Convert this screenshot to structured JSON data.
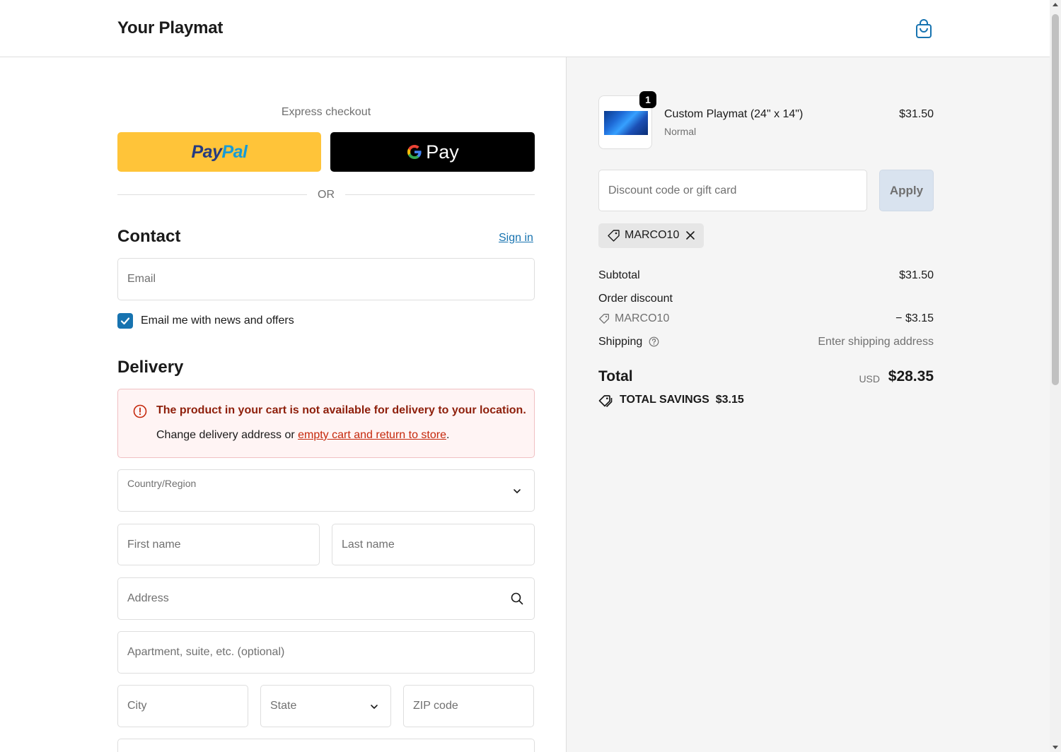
{
  "header": {
    "store_title": "Your Playmat",
    "cart_icon": "shopping-bag-icon"
  },
  "express": {
    "label": "Express checkout",
    "paypal_a": "Pay",
    "paypal_b": "Pal",
    "gpay_text": "Pay",
    "or_label": "OR"
  },
  "contact": {
    "heading": "Contact",
    "sign_in": "Sign in",
    "email_placeholder": "Email",
    "newsletter_label": "Email me with news and offers",
    "newsletter_checked": true
  },
  "delivery": {
    "heading": "Delivery",
    "alert_title": "The product in your cart is not available for delivery to your location.",
    "alert_body_prefix": "Change delivery address or ",
    "alert_link": "empty cart and return to store",
    "alert_body_suffix": ".",
    "country_label": "Country/Region",
    "country_value": "",
    "first_name_placeholder": "First name",
    "last_name_placeholder": "Last name",
    "address_placeholder": "Address",
    "apartment_placeholder": "Apartment, suite, etc. (optional)",
    "city_placeholder": "City",
    "state_placeholder": "State",
    "zip_placeholder": "ZIP code"
  },
  "summary": {
    "product": {
      "name": "Custom Playmat (24\" x 14\")",
      "variant": "Normal",
      "price": "$31.50",
      "quantity": "1"
    },
    "discount_placeholder": "Discount code or gift card",
    "apply_label": "Apply",
    "applied_code": "MARCO10",
    "subtotal_label": "Subtotal",
    "subtotal_value": "$31.50",
    "order_discount_label": "Order discount",
    "discount_code": "MARCO10",
    "discount_value": "− $3.15",
    "shipping_label": "Shipping",
    "shipping_value": "Enter shipping address",
    "total_label": "Total",
    "currency": "USD",
    "total_value": "$28.35",
    "savings_label": "TOTAL SAVINGS",
    "savings_value": "$3.15"
  },
  "colors": {
    "accent": "#1773b0",
    "paypal_yellow": "#ffc439",
    "error_text": "#8e1f0b",
    "error_bg": "#fff4f4"
  }
}
